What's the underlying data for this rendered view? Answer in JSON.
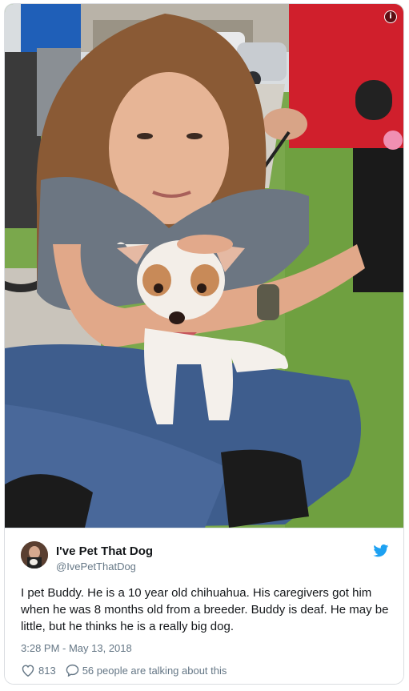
{
  "tweet": {
    "display_name": "I've Pet That Dog",
    "handle": "@IvePetThatDog",
    "text": "I pet Buddy. He is a 10 year old chihuahua. His caregivers got him when he was 8 months old from a breeder. Buddy is deaf. He may be little, but he thinks he is a really big dog.",
    "timestamp": "3:28 PM - May 13, 2018",
    "like_count": "813",
    "reply_text": "56 people are talking about this"
  },
  "icons": {
    "info": "info-icon",
    "twitter": "twitter-bird-icon",
    "heart": "heart-icon",
    "reply": "speech-bubble-icon"
  },
  "colors": {
    "twitter_blue": "#1da1f2",
    "text": "#14171a",
    "secondary": "#657786",
    "border": "#dadde1"
  }
}
